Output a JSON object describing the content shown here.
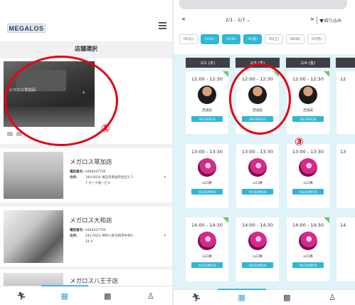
{
  "left_screen": {
    "logo": "MEGALOS",
    "page_title": "店舗選択",
    "featured_store": {
      "photo_label": "メガロス草加店"
    },
    "stores": [
      {
        "name": "メガロス草加店",
        "phone_label": "電話番号:",
        "phone": "0489247700",
        "address_label": "住所:",
        "address_line1": "340-0014 埼玉県草加市住吉1-7-",
        "address_line2": "7 オーク第一ビル"
      },
      {
        "name": "メガロス大和店",
        "phone_label": "電話番号:",
        "phone": "0462627700",
        "address_label": "住所:",
        "address_line1": "242-0021 神奈川県大和市中央5-",
        "address_line2": "14-4"
      },
      {
        "name": "メガロス八王子店"
      }
    ]
  },
  "right_screen": {
    "date_range": "2/1 - 2/7",
    "prev_arrow": "<",
    "next_arrow": ">",
    "filter_label": "絞り込み",
    "day_chips": [
      {
        "label": "01(火)",
        "selected": false
      },
      {
        "label": "02(水)",
        "selected": true
      },
      {
        "label": "03(木)",
        "selected": true
      },
      {
        "label": "04(金)",
        "selected": true
      },
      {
        "label": "05(土)",
        "selected": false
      },
      {
        "label": "06(日)",
        "selected": false
      },
      {
        "label": "07(月)",
        "selected": false
      }
    ],
    "day_headers": [
      "2/2 (水)",
      "2/3 (木)",
      "2/4 (金)"
    ],
    "slot_times": [
      "12:00 - 12:30",
      "12:00 - 12:30",
      "12:00 - 12:30",
      "12",
      "13:00 - 13:30",
      "13:00 - 13:30",
      "13:00 - 13:30",
      "13",
      "14:00 - 14:30",
      "14:00 - 14:30",
      "14:00 - 14:30",
      "14"
    ],
    "instructors": [
      "西浦誠",
      "山口舞"
    ],
    "programs": [
      "VOLTBOX30",
      "VOLTJUMP30"
    ]
  },
  "annotations": {
    "ring_2_label": "②",
    "ring_3_label": "③"
  },
  "colors": {
    "accent": "#2fb7d6",
    "annotation_red": "#e60012",
    "header_dark": "#3f3f43",
    "grid_bg": "#dff3f8"
  },
  "icons": [
    "menu-icon",
    "chevron-right-icon",
    "filter-icon",
    "run-icon",
    "calendar-icon",
    "qr-icon",
    "user-icon"
  ]
}
